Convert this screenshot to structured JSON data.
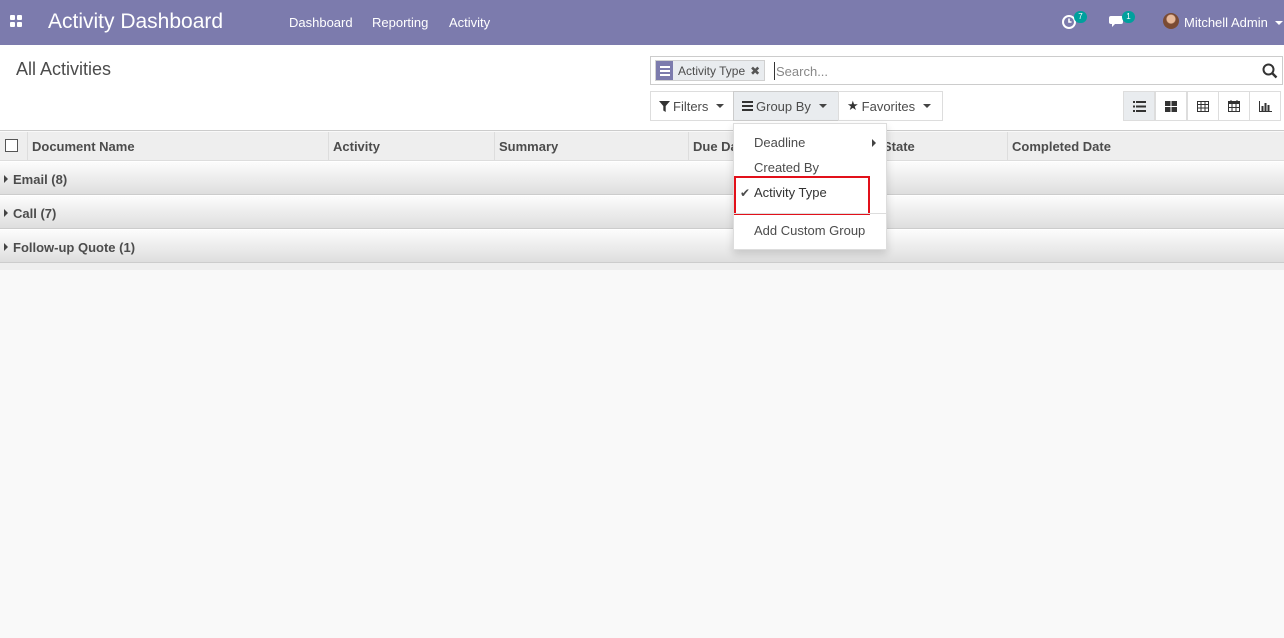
{
  "navbar": {
    "brand": "Activity Dashboard",
    "menu": [
      "Dashboard",
      "Reporting",
      "Activity"
    ],
    "activity_count": "7",
    "message_count": "1",
    "user_name": "Mitchell Admin",
    "color": "#7c7bad"
  },
  "control_panel": {
    "breadcrumb": "All Activities",
    "search": {
      "facet_label": "Activity Type",
      "placeholder": "Search..."
    },
    "buttons": {
      "filters": "Filters",
      "group_by": "Group By",
      "favorites": "Favorites"
    },
    "views": [
      "list-view-icon",
      "kanban-view-icon",
      "pivot-view-icon",
      "calendar-view-icon",
      "graph-view-icon"
    ]
  },
  "table": {
    "columns": [
      "Document Name",
      "Activity",
      "Summary",
      "Due Da",
      "State",
      "Completed Date"
    ],
    "groups": [
      "Email (8)",
      "Call (7)",
      "Follow-up Quote (1)"
    ]
  },
  "group_by_menu": {
    "items": [
      "Deadline",
      "Created By",
      "Activity Type"
    ],
    "selected": "Activity Type",
    "add_custom": "Add Custom Group",
    "highlight_color": "#e2101a"
  }
}
